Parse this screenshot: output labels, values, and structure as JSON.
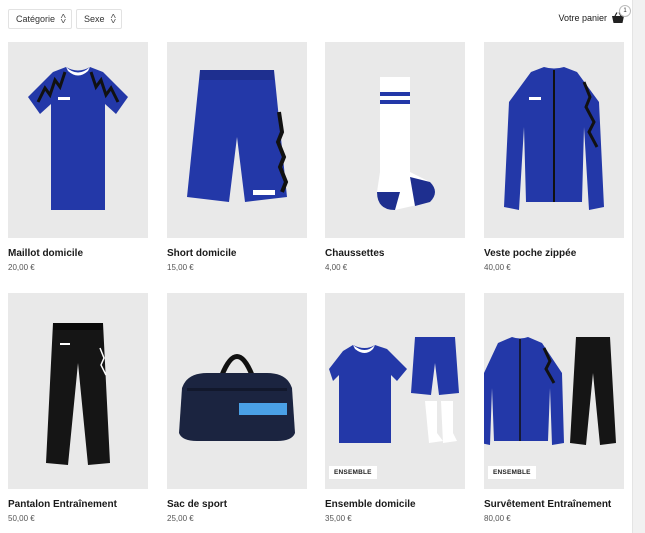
{
  "filters": {
    "category_label": "Catégorie",
    "sex_label": "Sexe"
  },
  "cart": {
    "label": "Votre panier",
    "count": "1"
  },
  "products": [
    {
      "name": "Maillot domicile",
      "price": "20,00 €",
      "icon": "jersey-image"
    },
    {
      "name": "Short domicile",
      "price": "15,00 €",
      "icon": "shorts-image"
    },
    {
      "name": "Chaussettes",
      "price": "4,00 €",
      "icon": "socks-image"
    },
    {
      "name": "Veste poche zippée",
      "price": "40,00 €",
      "icon": "jacket-image"
    },
    {
      "name": "Pantalon Entraînement",
      "price": "50,00 €",
      "icon": "pants-image"
    },
    {
      "name": "Sac de sport",
      "price": "25,00 €",
      "icon": "bag-image"
    },
    {
      "name": "Ensemble domicile",
      "price": "35,00 €",
      "tag": "ENSEMBLE",
      "icon": "kit-image"
    },
    {
      "name": "Survêtement Entraînement",
      "price": "80,00 €",
      "tag": "ENSEMBLE",
      "icon": "tracksuit-image"
    }
  ],
  "colors": {
    "royal_blue": "#2338a8",
    "navy": "#1b2440",
    "black": "#151515",
    "card_bg": "#e9e9e9"
  }
}
